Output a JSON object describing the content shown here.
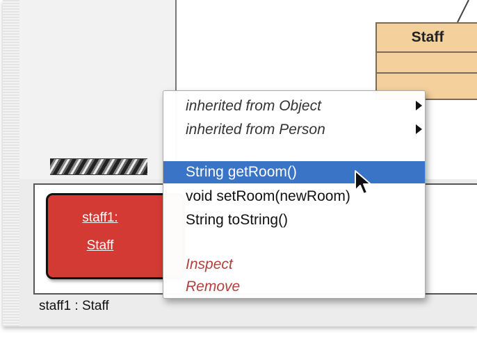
{
  "diagram": {
    "class_box": {
      "name": "Staff",
      "fill_color": "#f3d09c"
    }
  },
  "object_bench": {
    "object": {
      "line1": "staff1:",
      "line2": "Staff",
      "fill_color": "#d43a34"
    },
    "status_text": "staff1 : Staff"
  },
  "context_menu": {
    "submenus": [
      {
        "label": "inherited from Object"
      },
      {
        "label": "inherited from Person"
      }
    ],
    "methods": [
      {
        "label": "String getRoom()",
        "selected": true
      },
      {
        "label": "void setRoom(newRoom)"
      },
      {
        "label": "String toString()"
      }
    ],
    "actions": [
      {
        "label": "Inspect"
      },
      {
        "label": "Remove"
      }
    ],
    "highlight_color": "#3a74c7"
  },
  "icons": [
    "submenu-arrow-icon",
    "mouse-pointer-icon"
  ]
}
